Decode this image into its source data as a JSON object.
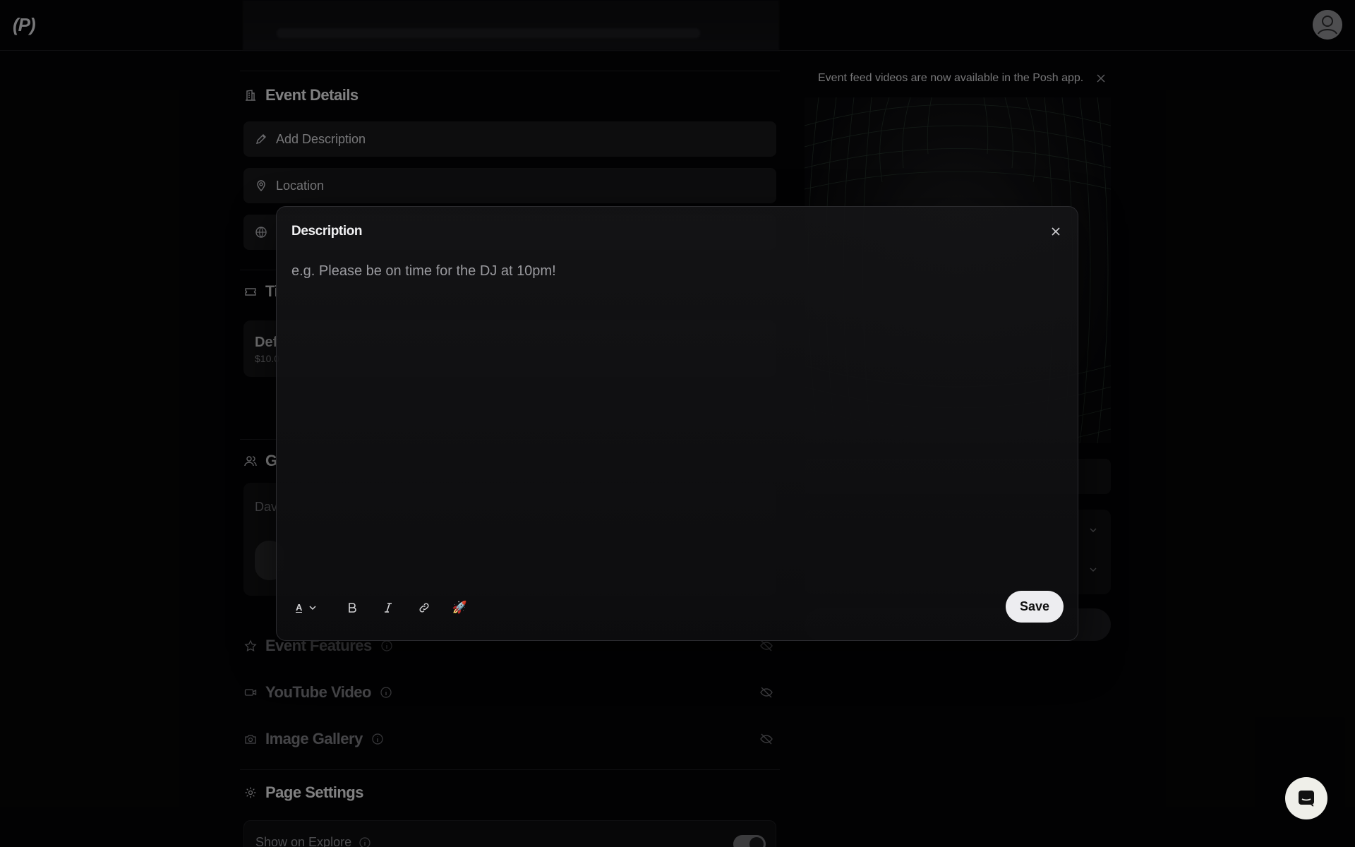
{
  "header": {
    "logo": "(P)",
    "avatar_icon": "user-icon"
  },
  "sections": {
    "event_details": "Event Details",
    "add_description": "Add Description",
    "location": "Location",
    "tickets_partial": "Ti",
    "ticket_name_partial": "Def",
    "ticket_price_partial": "$10.0",
    "guests_partial": "G",
    "guest_text_partial": "Dav",
    "event_features": "Event Features",
    "youtube_video": "YouTube Video",
    "image_gallery": "Image Gallery",
    "page_settings": "Page Settings",
    "show_on_explore": "Show on Explore"
  },
  "right_panel": {
    "notice": "Event feed videos are now available in the Posh app."
  },
  "modal": {
    "title": "Description",
    "placeholder": "e.g. Please be on time for the DJ at 10pm!",
    "save_label": "Save",
    "toolbar_text_size": "A",
    "toolbar_icons": [
      "text-size-icon",
      "bold-icon",
      "italic-icon",
      "link-icon",
      "rocket-icon"
    ]
  },
  "colors": {
    "background": "#050506",
    "field_bg": "#18181b",
    "save_button": "#ededf0",
    "chat_button": "#efefe9"
  }
}
